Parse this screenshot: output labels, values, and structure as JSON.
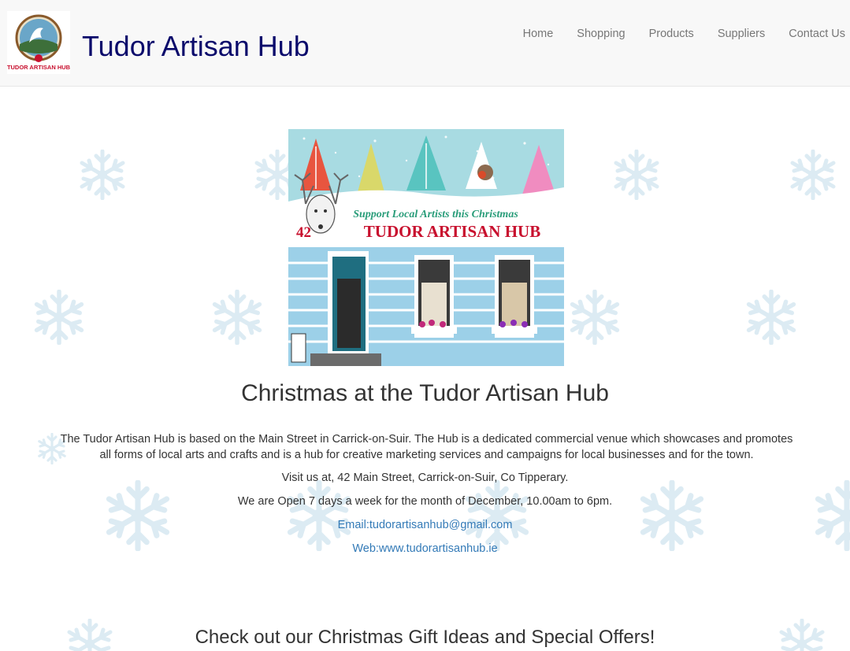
{
  "header": {
    "brand": "Tudor Artisan Hub",
    "logo_text": "TUDOR ARTISAN HUB",
    "nav": [
      "Home",
      "Shopping",
      "Products",
      "Suppliers",
      "Contact Us"
    ]
  },
  "hero": {
    "banner_line1": "Support Local Artists this Christmas",
    "banner_number": "42",
    "banner_line2": "TUDOR ARTISAN HUB"
  },
  "main": {
    "title": "Christmas at the Tudor Artisan Hub",
    "description": "The Tudor Artisan Hub is based on the Main Street in Carrick-on-Suir. The Hub is a dedicated commercial venue which showcases and promotes all forms of local arts and crafts and is a hub for creative marketing services and campaigns for local businesses and for the town.",
    "visit": "Visit us at, 42 Main Street, Carrick-on-Suir, Co Tipperary.",
    "hours": "We are Open 7 days a week for the month of December, 10.00am to 6pm.",
    "email": "Email:tudorartisanhub@gmail.com",
    "web": "Web:www.tudorartisanhub.ie",
    "subtitle": "Check out our Christmas Gift Ideas and Special Offers!"
  },
  "colors": {
    "brand": "#0a0a6b",
    "link": "#337ab7",
    "navbar_bg": "#f8f8f8",
    "snowflake": "#dcebf3"
  },
  "icons": [
    "snowflake-icon"
  ]
}
